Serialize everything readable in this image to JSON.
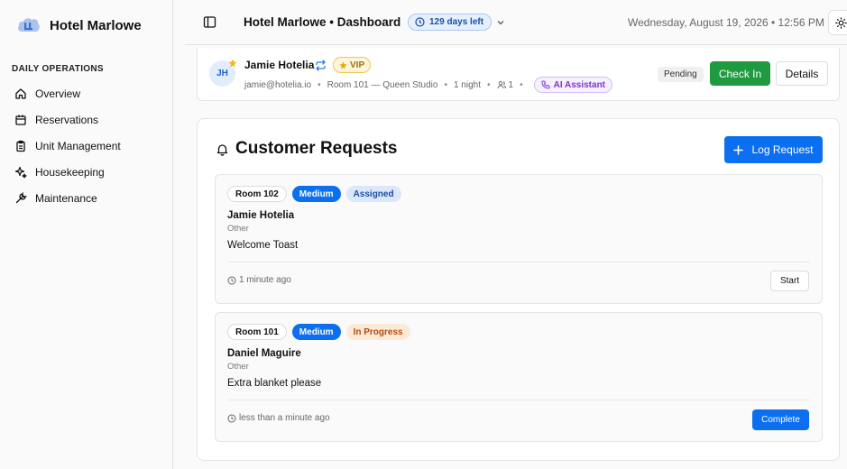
{
  "brand": {
    "name": "Hotel Marlowe",
    "logo_icon": "hotel-logo-icon",
    "logo_color": "#3b6fd1"
  },
  "sidebar": {
    "section_label": "DAILY OPERATIONS",
    "items": [
      {
        "label": "Overview",
        "icon": "home-icon"
      },
      {
        "label": "Reservations",
        "icon": "calendar-icon"
      },
      {
        "label": "Unit Management",
        "icon": "clipboard-icon"
      },
      {
        "label": "Housekeeping",
        "icon": "sparkles-icon"
      },
      {
        "label": "Maintenance",
        "icon": "wrench-icon"
      }
    ]
  },
  "header": {
    "title": "Hotel Marlowe • Dashboard",
    "days_left": "129 days left",
    "datetime": "Wednesday, August 19, 2026 • 12:56 PM"
  },
  "reservation": {
    "initials": "JH",
    "name": "Jamie Hotelia",
    "vip_label": "VIP",
    "email": "jamie@hotelia.io",
    "room": "Room 101 — Queen Studio",
    "nights": "1 night",
    "guests": "1",
    "ai_label": "AI Assistant",
    "status": "Pending",
    "check_in_label": "Check In",
    "details_label": "Details"
  },
  "requests": {
    "title": "Customer Requests",
    "log_label": "Log Request",
    "items": [
      {
        "room": "Room 102",
        "priority": "Medium",
        "status": "Assigned",
        "guest": "Jamie Hotelia",
        "type": "Other",
        "description": "Welcome Toast",
        "time": "1 minute ago",
        "action": "Start"
      },
      {
        "room": "Room 101",
        "priority": "Medium",
        "status": "In Progress",
        "guest": "Daniel Maguire",
        "type": "Other",
        "description": "Extra blanket please",
        "time": "less than a minute ago",
        "action": "Complete"
      }
    ]
  },
  "colors": {
    "primary": "#0b6ff0",
    "success": "#1f9a3f",
    "vip": "#f2c44f",
    "ai": "#7a34d6"
  }
}
